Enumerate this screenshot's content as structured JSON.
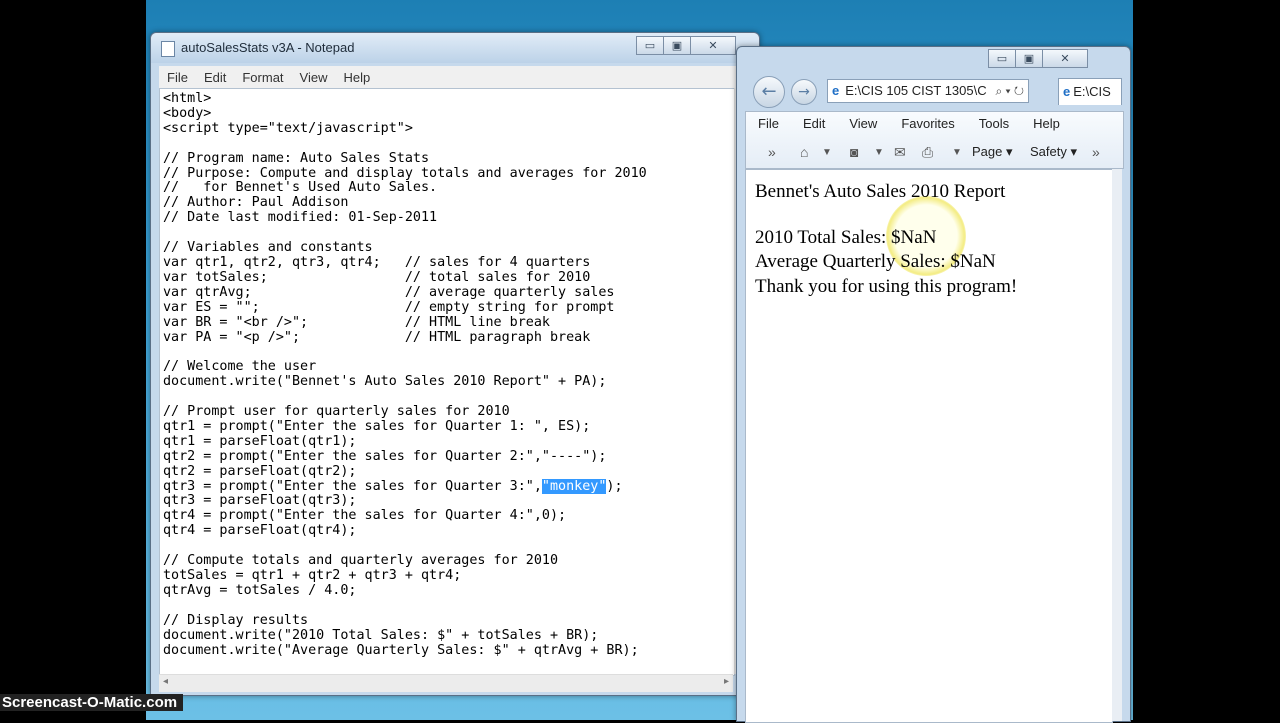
{
  "notepad": {
    "title": "autoSalesStats v3A - Notepad",
    "menu": [
      "File",
      "Edit",
      "Format",
      "View",
      "Help"
    ],
    "code_before_selection": "<html>\n<body>\n<script type=\"text/javascript\">\n\n// Program name: Auto Sales Stats\n// Purpose: Compute and display totals and averages for 2010\n//   for Bennet's Used Auto Sales.\n// Author: Paul Addison\n// Date last modified: 01-Sep-2011\n\n// Variables and constants\nvar qtr1, qtr2, qtr3, qtr4;   // sales for 4 quarters\nvar totSales;                 // total sales for 2010\nvar qtrAvg;                   // average quarterly sales\nvar ES = \"\";                  // empty string for prompt\nvar BR = \"<br />\";            // HTML line break\nvar PA = \"<p />\";             // HTML paragraph break\n\n// Welcome the user\ndocument.write(\"Bennet's Auto Sales 2010 Report\" + PA);\n\n// Prompt user for quarterly sales for 2010\nqtr1 = prompt(\"Enter the sales for Quarter 1: \", ES);\nqtr1 = parseFloat(qtr1);\nqtr2 = prompt(\"Enter the sales for Quarter 2:\",\"----\");\nqtr2 = parseFloat(qtr2);\nqtr3 = prompt(\"Enter the sales for Quarter 3:\",",
    "code_selection": "\"monkey\"",
    "code_after_selection": ");\nqtr3 = parseFloat(qtr3);\nqtr4 = prompt(\"Enter the sales for Quarter 4:\",0);\nqtr4 = parseFloat(qtr4);\n\n// Compute totals and quarterly averages for 2010\ntotSales = qtr1 + qtr2 + qtr3 + qtr4;\nqtrAvg = totSales / 4.0;\n\n// Display results\ndocument.write(\"2010 Total Sales: $\" + totSales + BR);\ndocument.write(\"Average Quarterly Sales: $\" + qtrAvg + BR);"
  },
  "caption_buttons": {
    "minimize": "▭",
    "maximize": "▣",
    "close": "✕"
  },
  "browser": {
    "address": "E:\\CIS 105 CIST 1305\\C",
    "tab_title": "E:\\CIS",
    "menu": [
      "File",
      "Edit",
      "View",
      "Favorites",
      "Tools",
      "Help"
    ],
    "toolbar": {
      "page_label": "Page ▾",
      "safety_label": "Safety ▾"
    },
    "content": {
      "heading": "Bennet's Auto Sales 2010 Report",
      "line1": "2010 Total Sales: $NaN",
      "line2": "Average Quarterly Sales: $NaN",
      "line3": "Thank you for using this program!"
    }
  },
  "watermark": "Screencast-O-Matic.com"
}
